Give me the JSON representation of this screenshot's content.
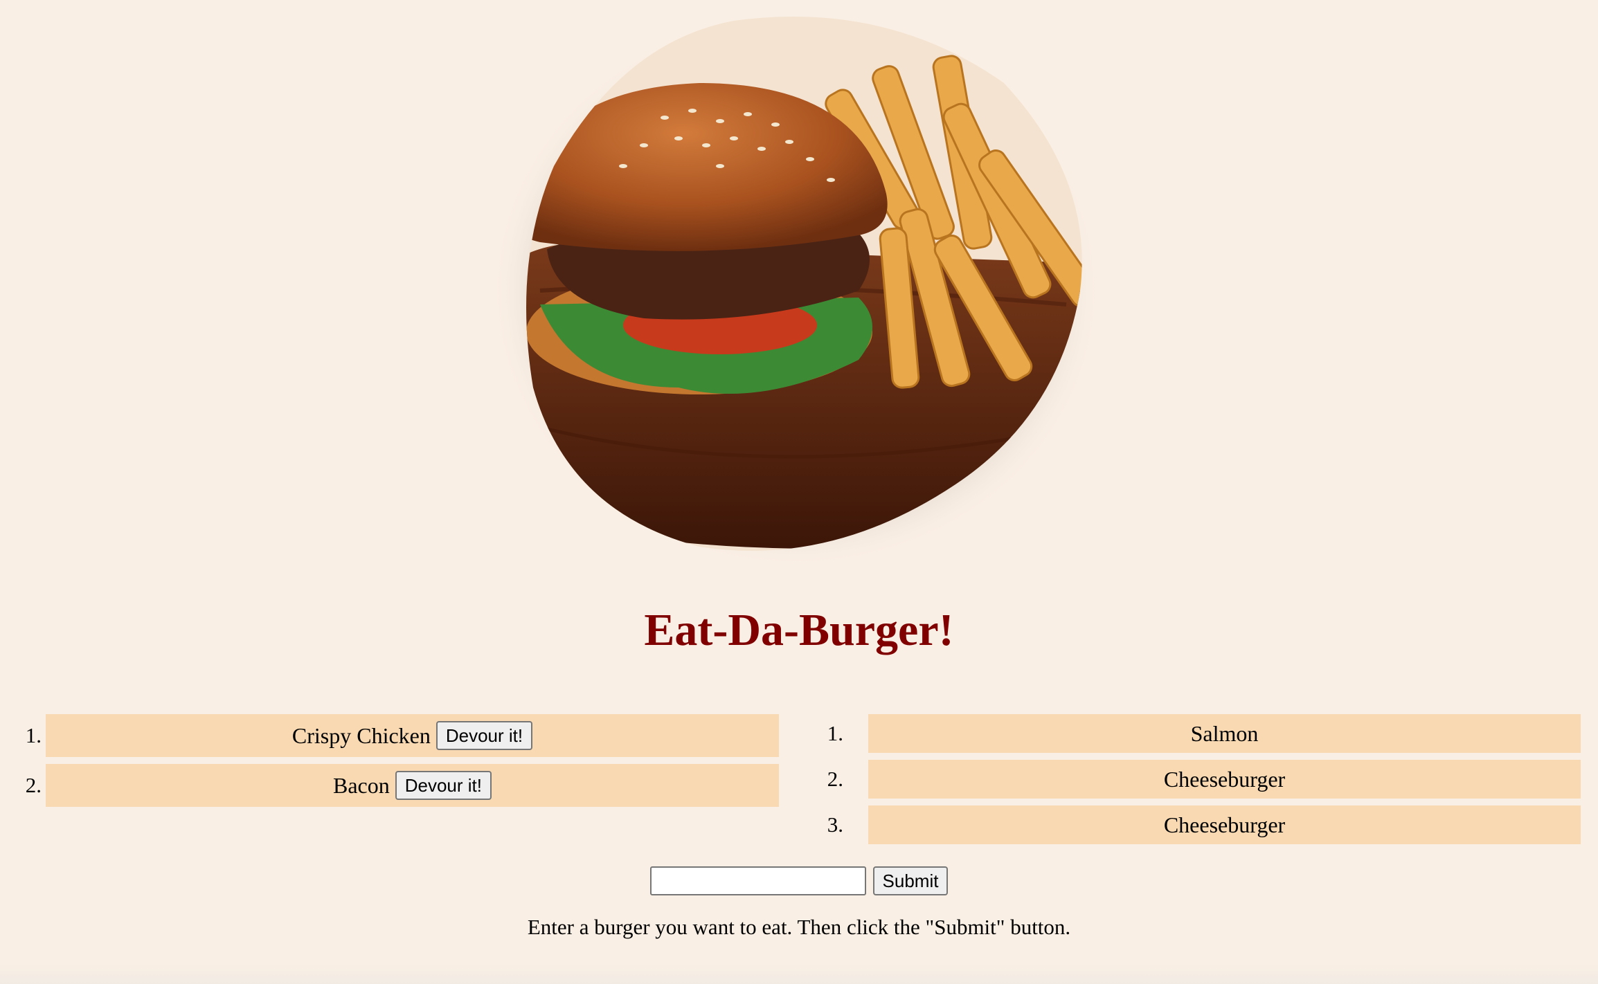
{
  "title": "Eat-Da-Burger!",
  "hero": {
    "icon": "burger-image"
  },
  "uneaten": [
    {
      "num": "1.",
      "name": "Crispy Chicken",
      "button": "Devour it!"
    },
    {
      "num": "2.",
      "name": "Bacon",
      "button": "Devour it!"
    }
  ],
  "devoured": [
    {
      "num": "1.",
      "name": "Salmon"
    },
    {
      "num": "2.",
      "name": "Cheeseburger"
    },
    {
      "num": "3.",
      "name": "Cheeseburger"
    }
  ],
  "form": {
    "input_value": "",
    "input_placeholder": "",
    "submit_label": "Submit"
  },
  "hint": "Enter a burger you want to eat. Then click the \"Submit\" button.",
  "colors": {
    "background": "#faefe4",
    "title": "#800000",
    "bar": "#f8d9b2"
  }
}
